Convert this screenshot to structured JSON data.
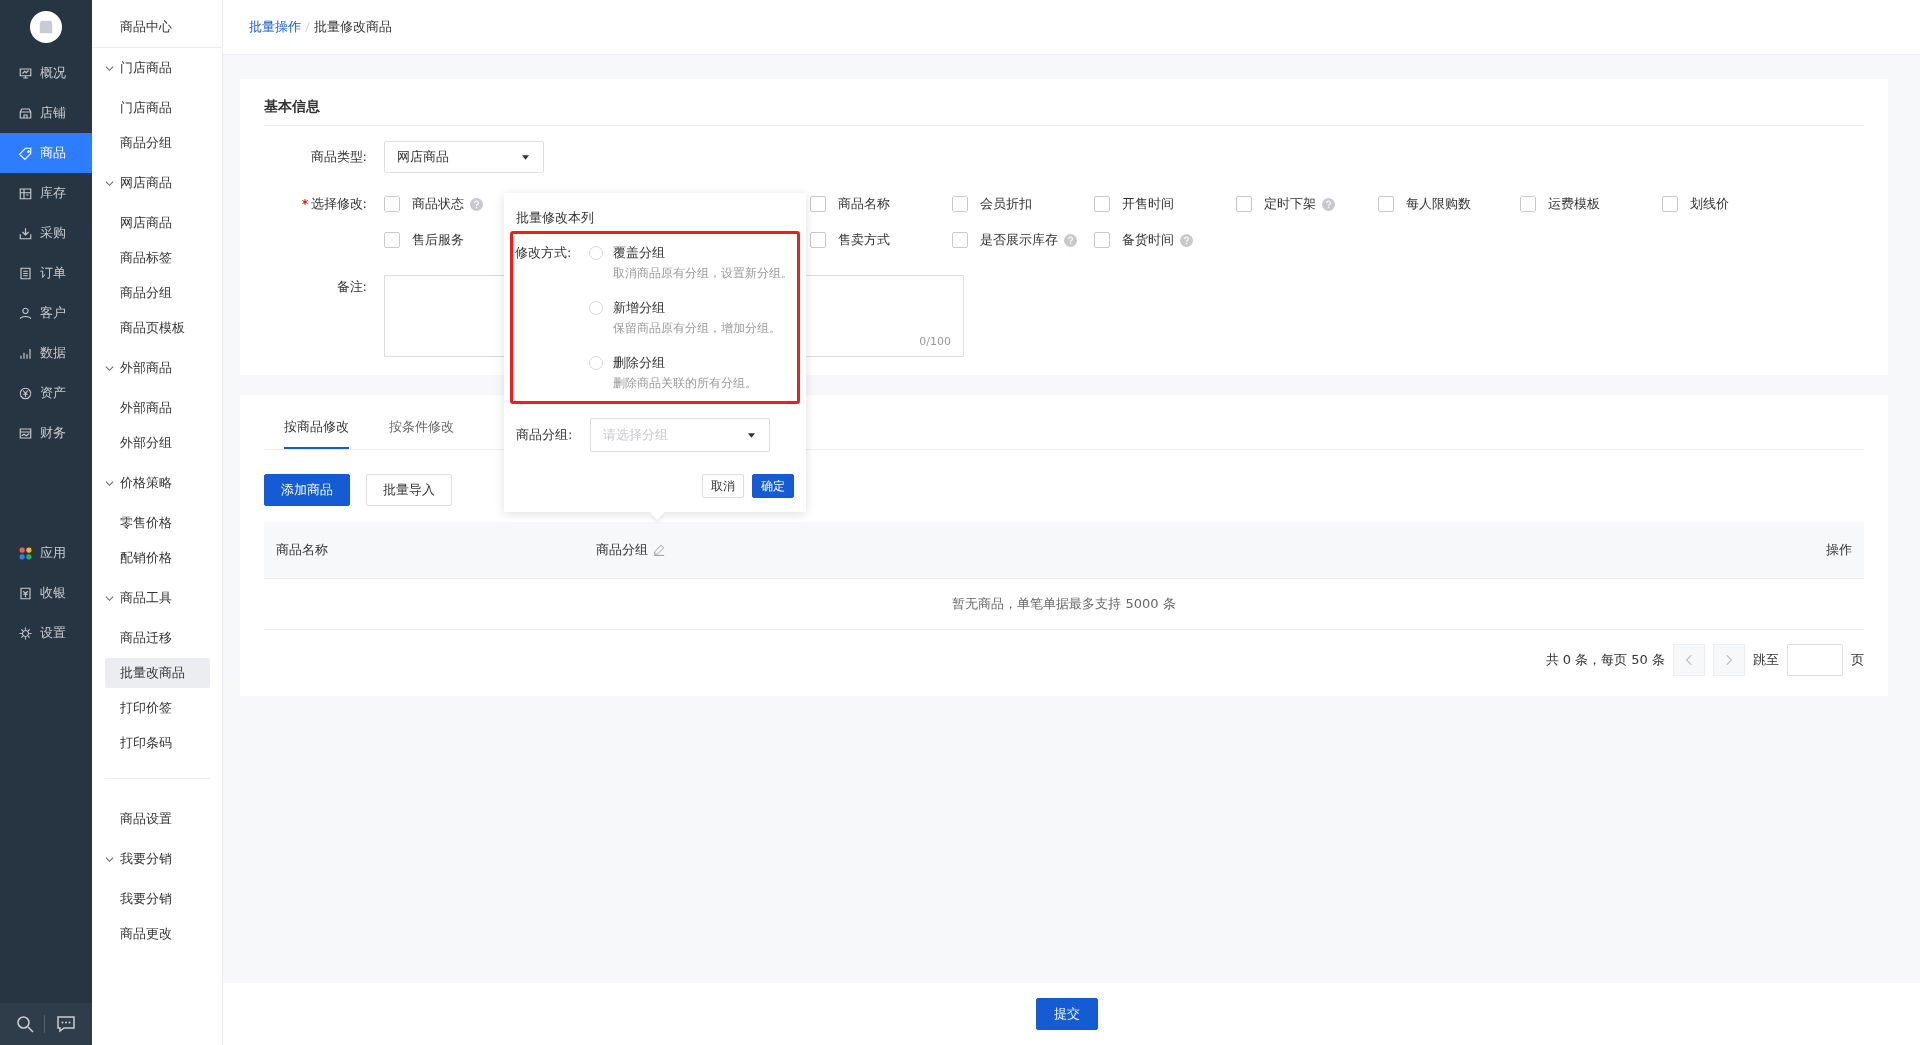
{
  "main_nav": {
    "items": [
      {
        "label": "概况",
        "selected": false
      },
      {
        "label": "店铺",
        "selected": false
      },
      {
        "label": "商品",
        "selected": true
      },
      {
        "label": "库存",
        "selected": false
      },
      {
        "label": "采购",
        "selected": false
      },
      {
        "label": "订单",
        "selected": false
      },
      {
        "label": "客户",
        "selected": false
      },
      {
        "label": "数据",
        "selected": false
      },
      {
        "label": "资产",
        "selected": false
      },
      {
        "label": "财务",
        "selected": false
      }
    ],
    "bottom_items": [
      {
        "label": "应用",
        "selected": false
      },
      {
        "label": "收银",
        "selected": false
      },
      {
        "label": "设置",
        "selected": false
      }
    ]
  },
  "sub_nav": {
    "sections": [
      {
        "title": "商品中心"
      },
      {
        "title": "门店商品",
        "expanded": true,
        "items": [
          {
            "label": "门店商品",
            "selected": false
          },
          {
            "label": "商品分组",
            "selected": false
          }
        ]
      },
      {
        "title": "网店商品",
        "expanded": true,
        "items": [
          {
            "label": "网店商品",
            "selected": false
          },
          {
            "label": "商品标签",
            "selected": false
          },
          {
            "label": "商品分组",
            "selected": false
          },
          {
            "label": "商品页模板",
            "selected": false
          }
        ]
      },
      {
        "title": "外部商品",
        "expanded": true,
        "items": [
          {
            "label": "外部商品",
            "selected": false
          },
          {
            "label": "外部分组",
            "selected": false
          }
        ]
      },
      {
        "title": "价格策略",
        "expanded": true,
        "items": [
          {
            "label": "零售价格",
            "selected": false
          },
          {
            "label": "配销价格",
            "selected": false
          }
        ]
      },
      {
        "title": "商品工具",
        "expanded": true,
        "items": [
          {
            "label": "商品迁移",
            "selected": false
          },
          {
            "label": "批量改商品",
            "selected": true
          },
          {
            "label": "打印价签",
            "selected": false
          },
          {
            "label": "打印条码",
            "selected": false
          }
        ]
      }
    ],
    "lower_sections": [
      {
        "title": "商品设置"
      },
      {
        "title": "我要分销",
        "expanded": true,
        "items": [
          {
            "label": "我要分销",
            "selected": false
          },
          {
            "label": "商品更改",
            "selected": false
          }
        ]
      }
    ]
  },
  "breadcrumb": [
    {
      "label": "批量操作",
      "kind": "link"
    },
    {
      "label": "批量修改商品",
      "kind": "current"
    }
  ],
  "basic_info": {
    "title": "基本信息",
    "type_field": {
      "label": "商品类型:",
      "value": "网店商品"
    },
    "select_field": {
      "label": "选择修改:",
      "required": true,
      "rows": [
        {
          "items": [
            {
              "label": "商品状态",
              "checked": false,
              "help": true
            },
            {
              "label": "商品名称",
              "checked": false,
              "help": false
            },
            {
              "label": "会员折扣",
              "checked": false,
              "help": false
            },
            {
              "label": "开售时间",
              "checked": false,
              "help": false
            },
            {
              "label": "定时下架",
              "checked": false,
              "help": true
            },
            {
              "label": "每人限购数",
              "checked": false,
              "help": false
            },
            {
              "label": "运费模板",
              "checked": false,
              "help": false
            },
            {
              "label": "划线价",
              "checked": false,
              "help": false
            }
          ]
        },
        {
          "items": [
            {
              "label": "售后服务",
              "checked": false,
              "help": false
            },
            {
              "label": "售卖方式",
              "checked": false,
              "help": false
            },
            {
              "label": "是否展示库存",
              "checked": false,
              "help": true
            },
            {
              "label": "备货时间",
              "checked": false,
              "help": true
            }
          ]
        }
      ]
    },
    "remark_field": {
      "label": "备注:",
      "counter": "0/100"
    }
  },
  "goods_panel": {
    "tabs": [
      {
        "label": "按商品修改",
        "selected": true
      },
      {
        "label": "按条件修改",
        "selected": false
      }
    ],
    "buttons": [
      {
        "label": "添加商品",
        "kind": "primary"
      },
      {
        "label": "批量导入",
        "kind": "default"
      }
    ],
    "table": {
      "columns": [
        {
          "label": "商品名称",
          "editable": false
        },
        {
          "label": "商品分组",
          "editable": true
        },
        {
          "label": "操作",
          "editable": false
        }
      ],
      "empty_text": "暂无商品，单笔单据最多支持 5000 条"
    },
    "pagination": {
      "summary": "共 0 条，每页 50 条",
      "jump_label": "跳至",
      "page_unit": "页"
    }
  },
  "popover": {
    "title": "批量修改本列",
    "mode_label": "修改方式:",
    "options": [
      {
        "label": "覆盖分组",
        "hint": "取消商品原有分组，设置新分组。",
        "selected": false
      },
      {
        "label": "新增分组",
        "hint": "保留商品原有分组，增加分组。",
        "selected": false
      },
      {
        "label": "删除分组",
        "hint": "删除商品关联的所有分组。",
        "selected": false
      }
    ],
    "group_label": "商品分组:",
    "group_placeholder": "请选择分组",
    "buttons": [
      {
        "label": "取消",
        "kind": "default"
      },
      {
        "label": "确定",
        "kind": "primary"
      }
    ]
  },
  "submit_button": "提交"
}
